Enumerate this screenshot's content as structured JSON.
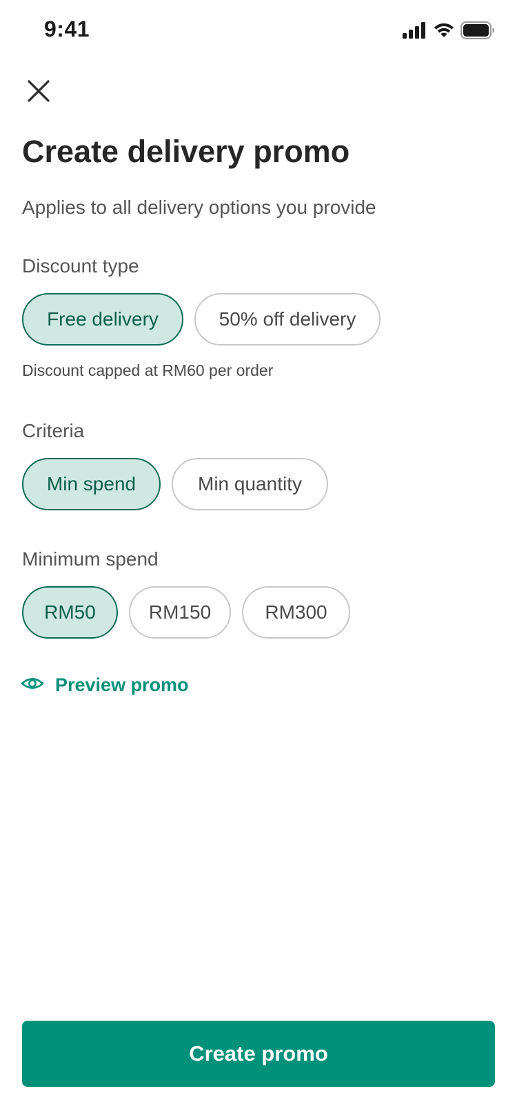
{
  "status_bar": {
    "time": "9:41",
    "icons": [
      "cellular-signal-icon",
      "wifi-icon",
      "battery-icon"
    ]
  },
  "header": {
    "close_icon": "close-icon",
    "title": "Create delivery promo",
    "subtitle": "Applies to all delivery options you provide"
  },
  "discount_type": {
    "label": "Discount type",
    "options": [
      "Free delivery",
      "50% off delivery"
    ],
    "selected": "Free delivery",
    "helper": "Discount capped at RM60 per order"
  },
  "criteria": {
    "label": "Criteria",
    "options": [
      "Min spend",
      "Min quantity"
    ],
    "selected": "Min spend"
  },
  "minimum_spend": {
    "label": "Minimum spend",
    "options": [
      "RM50",
      "RM150",
      "RM300"
    ],
    "selected": "RM50"
  },
  "preview": {
    "icon": "eye-icon",
    "label": "Preview promo"
  },
  "footer": {
    "create_label": "Create promo"
  },
  "colors": {
    "brand": "#00917a",
    "chip_selected_bg": "#cfe8e2",
    "chip_selected_border": "#0c6b55",
    "chip_border": "#c8c8c8"
  }
}
